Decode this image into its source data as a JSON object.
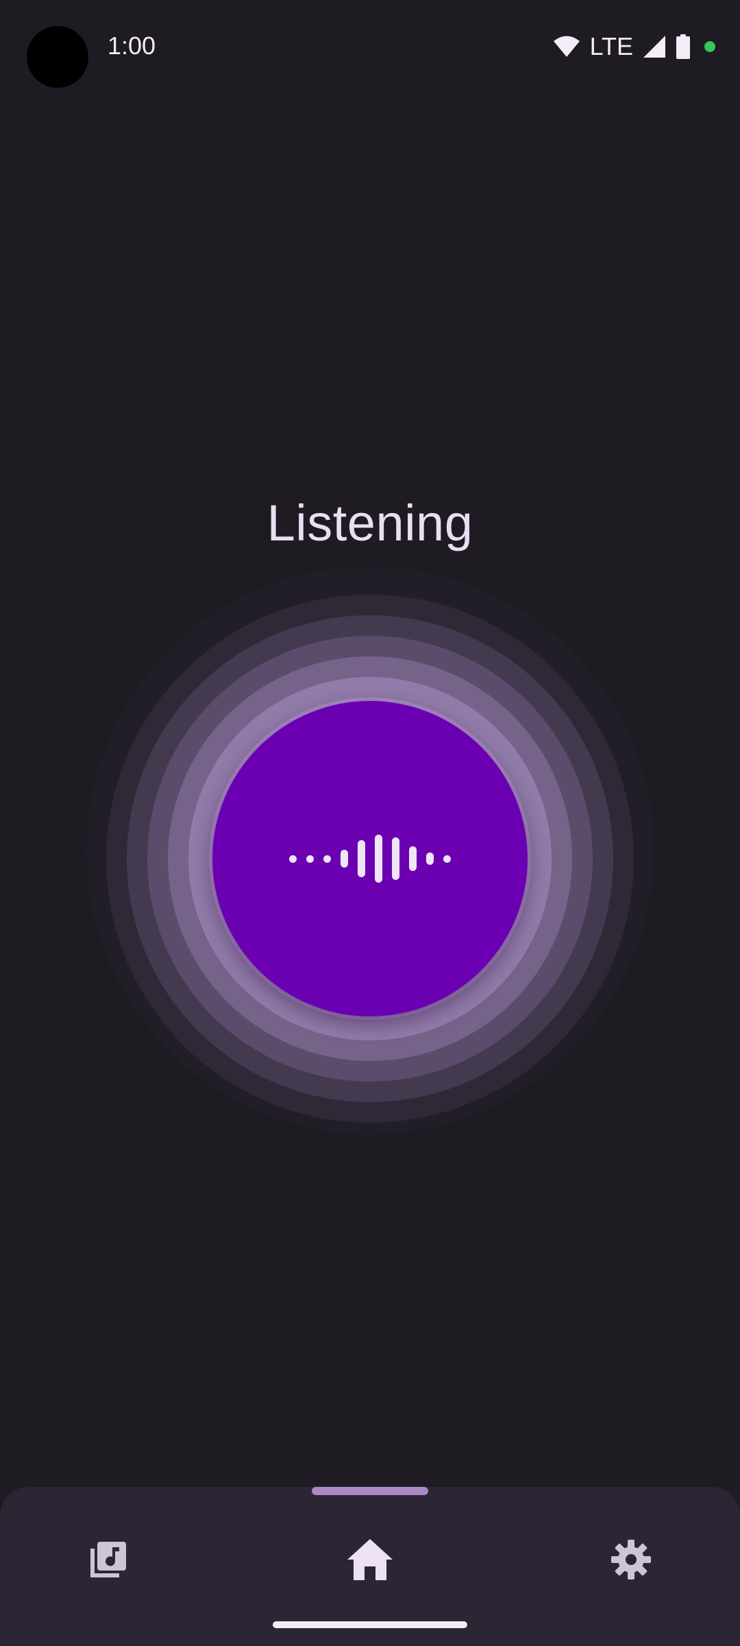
{
  "status_bar": {
    "time": "1:00",
    "network": "LTE",
    "icons": [
      "wifi-icon",
      "signal-icon",
      "battery-icon",
      "privacy-dot-icon"
    ]
  },
  "main": {
    "title": "Listening",
    "button_icon": "sound-wave-icon"
  },
  "bottom_nav": {
    "items": [
      {
        "name": "library",
        "icon": "music-library-icon",
        "selected": false
      },
      {
        "name": "home",
        "icon": "home-icon",
        "selected": true
      },
      {
        "name": "settings",
        "icon": "gear-icon",
        "selected": false
      }
    ]
  },
  "colors": {
    "background": "#1f1b23",
    "accent": "#6a00b2",
    "ring_light": "#aa8cc4",
    "nav_background": "#2c2533",
    "text": "#e9dff0"
  }
}
